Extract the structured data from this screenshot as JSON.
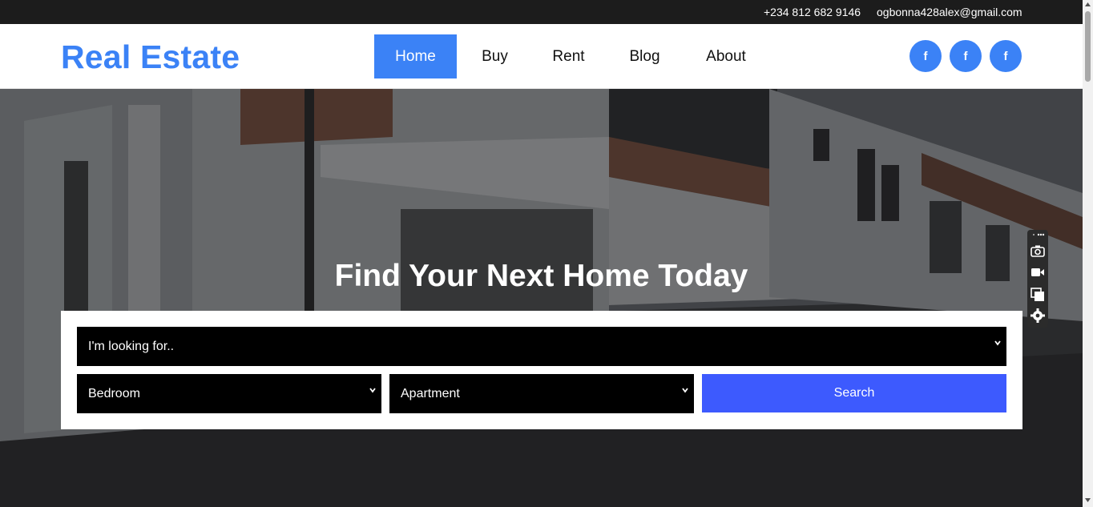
{
  "topbar": {
    "phone": "+234 812 682 9146",
    "email": "ogbonna428alex@gmail.com"
  },
  "header": {
    "logo": "Real Estate",
    "nav": [
      {
        "label": "Home",
        "active": true
      },
      {
        "label": "Buy",
        "active": false
      },
      {
        "label": "Rent",
        "active": false
      },
      {
        "label": "Blog",
        "active": false
      },
      {
        "label": "About",
        "active": false
      }
    ],
    "social": [
      {
        "icon": "facebook-icon",
        "glyph": "f"
      },
      {
        "icon": "facebook-icon",
        "glyph": "f"
      },
      {
        "icon": "facebook-icon",
        "glyph": "f"
      }
    ]
  },
  "hero": {
    "title": "Find Your Next Home Today"
  },
  "search": {
    "looking_for": "I'm looking for..",
    "bedroom": "Bedroom",
    "property_type": "Apartment",
    "button": "Search"
  },
  "toolbar": {
    "icons": [
      "camera-icon",
      "video-icon",
      "window-icon",
      "settings-icon"
    ]
  },
  "colors": {
    "accent": "#3b82f6",
    "search_button": "#3d5afe",
    "topbar": "#1c1c1c"
  }
}
